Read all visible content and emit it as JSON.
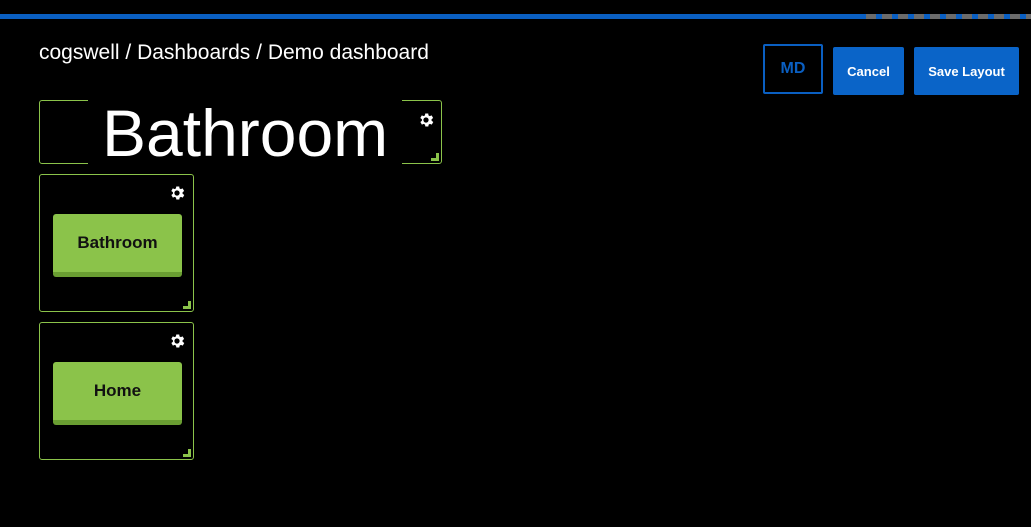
{
  "breadcrumb": {
    "org": "cogswell",
    "sep1": " / ",
    "section": "Dashboards",
    "sep2": " / ",
    "dashboard": "Demo dashboard"
  },
  "toolbar": {
    "size_label": "MD",
    "cancel_label": "Cancel",
    "save_label": "Save Layout"
  },
  "widgets": {
    "title_widget": {
      "text": "Bathroom"
    },
    "button_widget_1": {
      "label": "Bathroom"
    },
    "button_widget_2": {
      "label": "Home"
    }
  },
  "colors": {
    "accent": "#0a5fc2",
    "widget_border": "#8bc34a",
    "button_green": "#8bc34a"
  },
  "icons": {
    "settings": "gear-icon",
    "resize": "resize-handle-icon"
  }
}
